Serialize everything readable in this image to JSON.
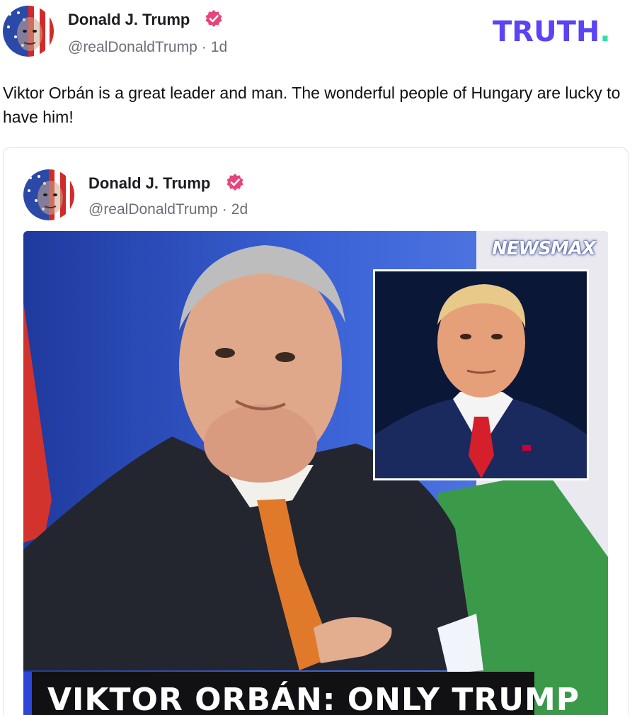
{
  "brand": {
    "logo_text": "TRUTH",
    "logo_dot": ".",
    "accent": "#5a44f5",
    "dot_color": "#2ee0a8"
  },
  "post": {
    "author_name": "Donald J. Trump",
    "handle": "@realDonaldTrump",
    "separator": "·",
    "age": "1d",
    "avatar_icon": "flag-portrait-avatar",
    "verified_icon": "verified-badge-icon",
    "verified_color": "#e8457b",
    "text": "Viktor Orbán is a great leader and man. The wonderful people of Hungary are lucky to have him!"
  },
  "quoted_post": {
    "author_name": "Donald J. Trump",
    "handle": "@realDonaldTrump",
    "separator": "·",
    "age": "2d",
    "media": {
      "watermark": "NEWSMAX",
      "headline": "VIKTOR ORBÁN: ONLY TRUMP"
    }
  }
}
